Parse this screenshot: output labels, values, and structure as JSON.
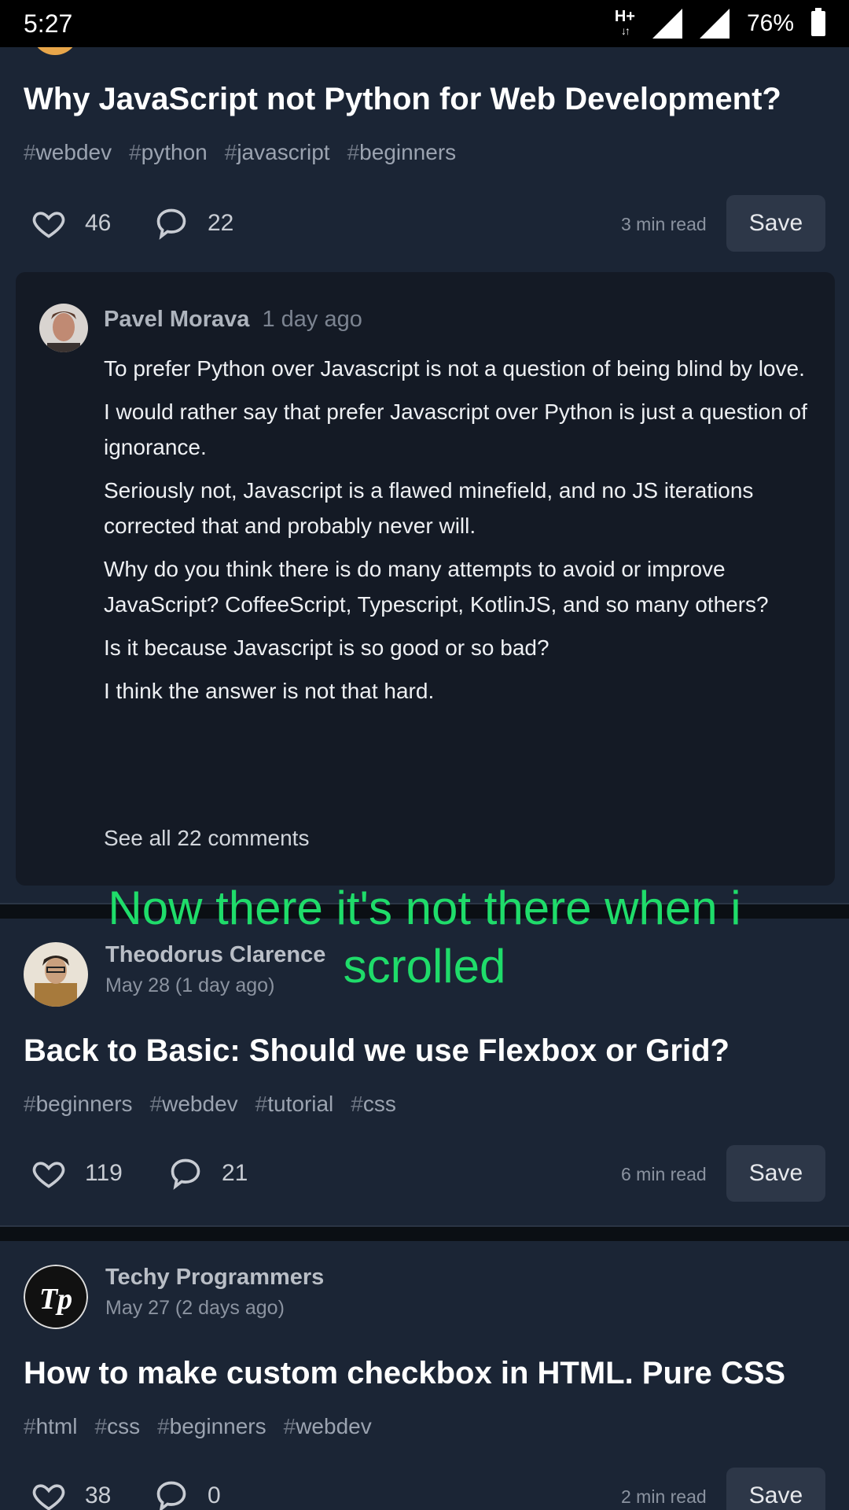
{
  "status_bar": {
    "time": "5:27",
    "network": "H+",
    "battery": "76%"
  },
  "post1": {
    "title": "Why JavaScript not Python for Web Development?",
    "tags": [
      "webdev",
      "python",
      "javascript",
      "beginners"
    ],
    "likes": "46",
    "comments": "22",
    "read_time": "3 min read",
    "save_label": "Save"
  },
  "comment": {
    "author": "Pavel Morava",
    "date": "1 day ago",
    "paragraphs": [
      "To prefer Python over Javascript is not a question of being blind by love.",
      "I would rather say that prefer Javascript over Python is just a question of ignorance.",
      "Seriously not, Javascript is a flawed minefield, and no JS iterations corrected that and probably never will.",
      "Why do you think there is do many attempts to avoid or improve JavaScript? CoffeeScript, Typescript, KotlinJS, and so many others?",
      "Is it because Javascript is so good or so bad?",
      "I think the answer is not that hard."
    ],
    "see_all": "See all 22 comments"
  },
  "overlay_note": {
    "line1": "Now there it's not there when i",
    "line2": "scrolled"
  },
  "post2": {
    "author": "Theodorus Clarence",
    "date": "May 28 (1 day ago)",
    "title": "Back to Basic: Should we use Flexbox or Grid?",
    "tags": [
      "beginners",
      "webdev",
      "tutorial",
      "css"
    ],
    "likes": "119",
    "comments": "21",
    "read_time": "6 min read",
    "save_label": "Save"
  },
  "post3": {
    "author": "Techy Programmers",
    "date": "May 27 (2 days ago)",
    "title": "How to make custom checkbox in HTML. Pure CSS",
    "tags": [
      "html",
      "css",
      "beginners",
      "webdev"
    ],
    "likes": "38",
    "comments": "0",
    "read_time": "2 min read",
    "save_label": "Save"
  },
  "colors": {
    "card_bg": "#1b2535",
    "page_bg": "#0b0f14",
    "comment_bg": "#141a25",
    "overlay_text": "#1fdc6a"
  }
}
